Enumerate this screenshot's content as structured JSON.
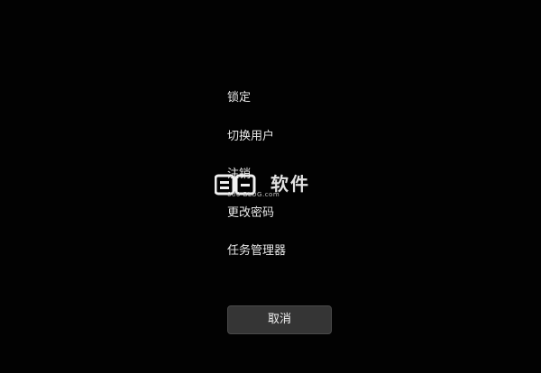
{
  "menu": {
    "items": [
      {
        "label": "锁定"
      },
      {
        "label": "切换用户"
      },
      {
        "label": "注销"
      },
      {
        "label": "更改密码"
      },
      {
        "label": "任务管理器"
      }
    ]
  },
  "cancel_label": "取消",
  "watermark": {
    "main": "软件",
    "sub": "000 BLOG.com"
  },
  "colors": {
    "background": "#020202",
    "text": "#e8e8e8",
    "button_bg": "#353535"
  }
}
